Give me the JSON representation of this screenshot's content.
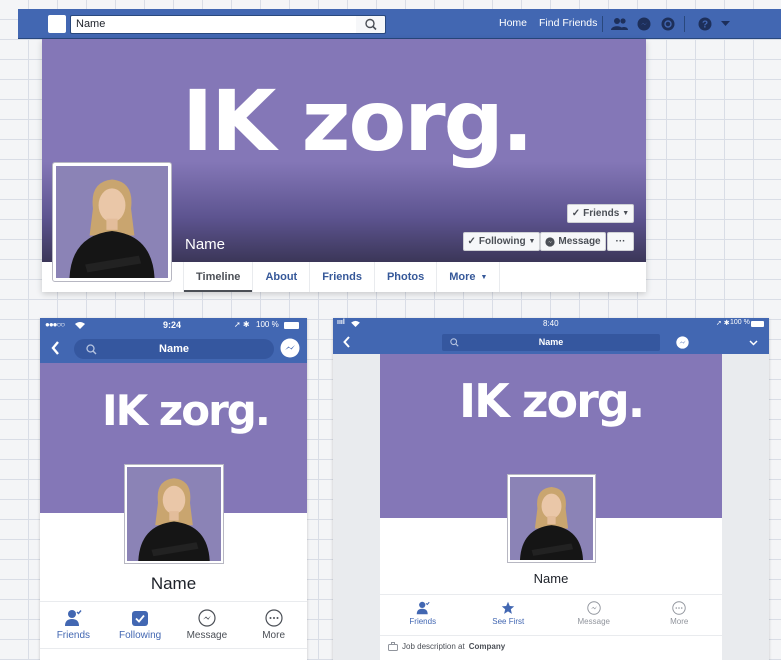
{
  "desktop": {
    "search": {
      "value": "Name"
    },
    "nav": {
      "home": "Home",
      "find_friends": "Find Friends"
    },
    "cover": {
      "logo_text": "IK zorg."
    },
    "profile": {
      "name": "Name"
    },
    "buttons": {
      "friends": "Friends",
      "following": "Following",
      "message": "Message",
      "more": "···"
    },
    "tabs": [
      "Timeline",
      "About",
      "Friends",
      "Photos",
      "More"
    ]
  },
  "mobile": {
    "status": {
      "carrier": "●●●○○",
      "time": "9:24",
      "battery": "100 %"
    },
    "search_title": "Name",
    "cover": {
      "logo_text": "IK zorg."
    },
    "profile_name": "Name",
    "actions": [
      "Friends",
      "Following",
      "Message",
      "More"
    ]
  },
  "tablet": {
    "status": {
      "time": "8:40",
      "battery": "100 %"
    },
    "search_title": "Name",
    "cover": {
      "logo_text": "IK zorg."
    },
    "profile_name": "Name",
    "actions": [
      "Friends",
      "See First",
      "Message",
      "More"
    ],
    "job": {
      "prefix": "Job description at",
      "company": "Company"
    }
  },
  "colors": {
    "facebook_blue": "#4267b2",
    "cover_purple": "#8477b7",
    "link_blue": "#365899"
  },
  "icons": [
    "search-icon",
    "friend-requests-icon",
    "messenger-icon",
    "notifications-icon",
    "help-icon",
    "back-icon",
    "checkmark-icon",
    "chevron-down-icon",
    "wifi-icon",
    "battery-icon",
    "star-icon",
    "briefcase-icon",
    "ellipsis-icon"
  ]
}
